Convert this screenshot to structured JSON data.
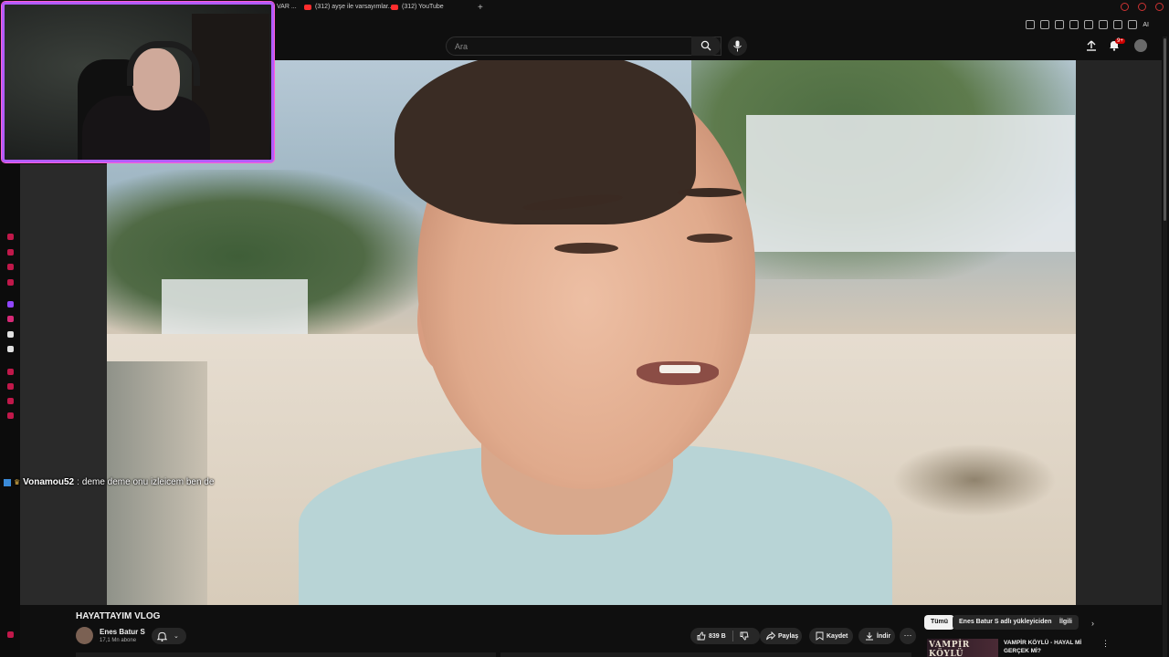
{
  "browser": {
    "tabs": [
      {
        "label": "VAR ..."
      },
      {
        "label": "(312) ayşe ile varsayımlar..."
      },
      {
        "label": "(312) YouTube"
      }
    ],
    "new_tab_symbol": "+",
    "extensions": {
      "ai_label": "AI"
    }
  },
  "search": {
    "placeholder": "Ara"
  },
  "header": {
    "notification_count": "9+"
  },
  "chat": {
    "username": "Vonamou52",
    "separator": ":",
    "message": "deme deme onu izleicem ben de"
  },
  "video": {
    "title": "HAYATTAYIM VLOG"
  },
  "channel": {
    "name": "Enes Batur S",
    "subscribers": "17,1 Mn abone"
  },
  "actions": {
    "likes": "839 B",
    "share": "Paylaş",
    "save": "Kaydet",
    "download": "İndir",
    "more": "⋯"
  },
  "chips": [
    {
      "label": "Tümü",
      "active": true
    },
    {
      "label": "Enes Batur S adlı yükleyiciden",
      "active": false
    },
    {
      "label": "İlgili",
      "active": false
    }
  ],
  "chip_next": "›",
  "recommendation": {
    "thumb_text": "VAMPİR KÖYLÜ",
    "title": "VAMPİR KÖYLÜ - HAYAL Mİ GERÇEK Mİ?",
    "menu": "⋮"
  },
  "colors": {
    "webcam_border": "#b35cff",
    "background": "#0f0f0f",
    "accent_red": "#cc0000"
  }
}
